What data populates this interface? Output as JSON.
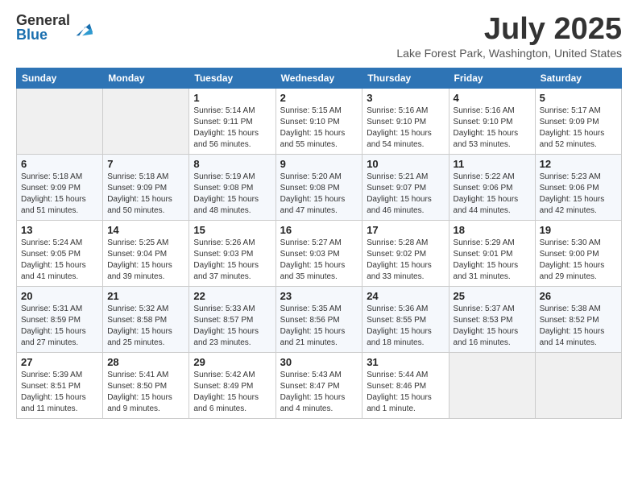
{
  "logo": {
    "general": "General",
    "blue": "Blue"
  },
  "title": "July 2025",
  "location": "Lake Forest Park, Washington, United States",
  "days_header": [
    "Sunday",
    "Monday",
    "Tuesday",
    "Wednesday",
    "Thursday",
    "Friday",
    "Saturday"
  ],
  "weeks": [
    [
      {
        "day": "",
        "info": ""
      },
      {
        "day": "",
        "info": ""
      },
      {
        "day": "1",
        "info": "Sunrise: 5:14 AM\nSunset: 9:11 PM\nDaylight: 15 hours\nand 56 minutes."
      },
      {
        "day": "2",
        "info": "Sunrise: 5:15 AM\nSunset: 9:10 PM\nDaylight: 15 hours\nand 55 minutes."
      },
      {
        "day": "3",
        "info": "Sunrise: 5:16 AM\nSunset: 9:10 PM\nDaylight: 15 hours\nand 54 minutes."
      },
      {
        "day": "4",
        "info": "Sunrise: 5:16 AM\nSunset: 9:10 PM\nDaylight: 15 hours\nand 53 minutes."
      },
      {
        "day": "5",
        "info": "Sunrise: 5:17 AM\nSunset: 9:09 PM\nDaylight: 15 hours\nand 52 minutes."
      }
    ],
    [
      {
        "day": "6",
        "info": "Sunrise: 5:18 AM\nSunset: 9:09 PM\nDaylight: 15 hours\nand 51 minutes."
      },
      {
        "day": "7",
        "info": "Sunrise: 5:18 AM\nSunset: 9:09 PM\nDaylight: 15 hours\nand 50 minutes."
      },
      {
        "day": "8",
        "info": "Sunrise: 5:19 AM\nSunset: 9:08 PM\nDaylight: 15 hours\nand 48 minutes."
      },
      {
        "day": "9",
        "info": "Sunrise: 5:20 AM\nSunset: 9:08 PM\nDaylight: 15 hours\nand 47 minutes."
      },
      {
        "day": "10",
        "info": "Sunrise: 5:21 AM\nSunset: 9:07 PM\nDaylight: 15 hours\nand 46 minutes."
      },
      {
        "day": "11",
        "info": "Sunrise: 5:22 AM\nSunset: 9:06 PM\nDaylight: 15 hours\nand 44 minutes."
      },
      {
        "day": "12",
        "info": "Sunrise: 5:23 AM\nSunset: 9:06 PM\nDaylight: 15 hours\nand 42 minutes."
      }
    ],
    [
      {
        "day": "13",
        "info": "Sunrise: 5:24 AM\nSunset: 9:05 PM\nDaylight: 15 hours\nand 41 minutes."
      },
      {
        "day": "14",
        "info": "Sunrise: 5:25 AM\nSunset: 9:04 PM\nDaylight: 15 hours\nand 39 minutes."
      },
      {
        "day": "15",
        "info": "Sunrise: 5:26 AM\nSunset: 9:03 PM\nDaylight: 15 hours\nand 37 minutes."
      },
      {
        "day": "16",
        "info": "Sunrise: 5:27 AM\nSunset: 9:03 PM\nDaylight: 15 hours\nand 35 minutes."
      },
      {
        "day": "17",
        "info": "Sunrise: 5:28 AM\nSunset: 9:02 PM\nDaylight: 15 hours\nand 33 minutes."
      },
      {
        "day": "18",
        "info": "Sunrise: 5:29 AM\nSunset: 9:01 PM\nDaylight: 15 hours\nand 31 minutes."
      },
      {
        "day": "19",
        "info": "Sunrise: 5:30 AM\nSunset: 9:00 PM\nDaylight: 15 hours\nand 29 minutes."
      }
    ],
    [
      {
        "day": "20",
        "info": "Sunrise: 5:31 AM\nSunset: 8:59 PM\nDaylight: 15 hours\nand 27 minutes."
      },
      {
        "day": "21",
        "info": "Sunrise: 5:32 AM\nSunset: 8:58 PM\nDaylight: 15 hours\nand 25 minutes."
      },
      {
        "day": "22",
        "info": "Sunrise: 5:33 AM\nSunset: 8:57 PM\nDaylight: 15 hours\nand 23 minutes."
      },
      {
        "day": "23",
        "info": "Sunrise: 5:35 AM\nSunset: 8:56 PM\nDaylight: 15 hours\nand 21 minutes."
      },
      {
        "day": "24",
        "info": "Sunrise: 5:36 AM\nSunset: 8:55 PM\nDaylight: 15 hours\nand 18 minutes."
      },
      {
        "day": "25",
        "info": "Sunrise: 5:37 AM\nSunset: 8:53 PM\nDaylight: 15 hours\nand 16 minutes."
      },
      {
        "day": "26",
        "info": "Sunrise: 5:38 AM\nSunset: 8:52 PM\nDaylight: 15 hours\nand 14 minutes."
      }
    ],
    [
      {
        "day": "27",
        "info": "Sunrise: 5:39 AM\nSunset: 8:51 PM\nDaylight: 15 hours\nand 11 minutes."
      },
      {
        "day": "28",
        "info": "Sunrise: 5:41 AM\nSunset: 8:50 PM\nDaylight: 15 hours\nand 9 minutes."
      },
      {
        "day": "29",
        "info": "Sunrise: 5:42 AM\nSunset: 8:49 PM\nDaylight: 15 hours\nand 6 minutes."
      },
      {
        "day": "30",
        "info": "Sunrise: 5:43 AM\nSunset: 8:47 PM\nDaylight: 15 hours\nand 4 minutes."
      },
      {
        "day": "31",
        "info": "Sunrise: 5:44 AM\nSunset: 8:46 PM\nDaylight: 15 hours\nand 1 minute."
      },
      {
        "day": "",
        "info": ""
      },
      {
        "day": "",
        "info": ""
      }
    ]
  ]
}
